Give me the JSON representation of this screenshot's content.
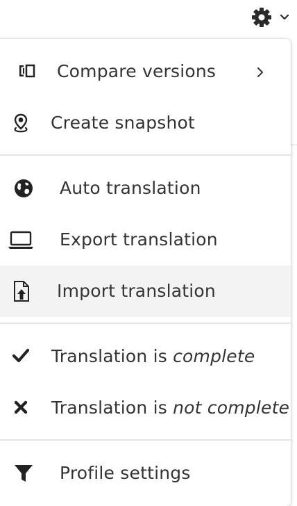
{
  "toolbar": {
    "settings_icon": "gear-icon",
    "dropdown_icon": "chevron-down-icon"
  },
  "menu": {
    "compare_versions": {
      "label": "Compare versions",
      "icon": "compare-icon",
      "submenu_icon": "chevron-right-icon"
    },
    "create_snapshot": {
      "label": "Create snapshot",
      "icon": "map-pin-icon"
    },
    "auto_translation": {
      "label": "Auto translation",
      "icon": "globe-icon"
    },
    "export_translation": {
      "label": "Export translation",
      "icon": "laptop-icon"
    },
    "import_translation": {
      "label": "Import translation",
      "icon": "file-upload-icon"
    },
    "mark_complete": {
      "prefix": "Translation is ",
      "emphasis": "complete",
      "icon": "check-icon"
    },
    "mark_not_complete": {
      "prefix": "Translation is ",
      "emphasis": "not complete",
      "icon": "x-icon"
    },
    "profile_settings": {
      "label": "Profile settings",
      "icon": "filter-icon"
    }
  },
  "colors": {
    "text": "#333333",
    "icon": "#222222",
    "highlight": "#f3f3f3",
    "divider": "#e3e3e3"
  }
}
